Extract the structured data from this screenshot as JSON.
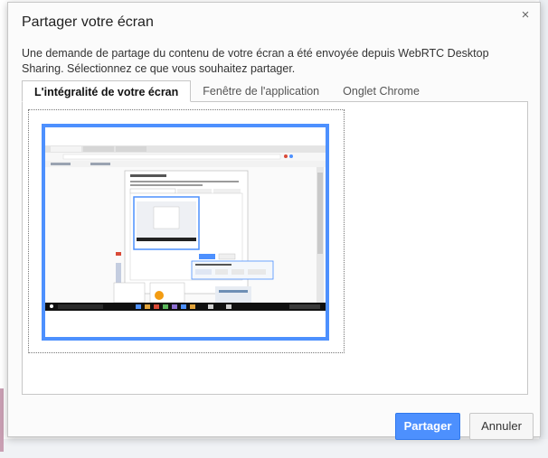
{
  "dialog": {
    "title": "Partager votre écran",
    "close_glyph": "×",
    "description": "Une demande de partage du contenu de votre écran a été envoyée depuis WebRTC Desktop Sharing. Sélectionnez ce que vous souhaitez partager."
  },
  "tabs": [
    {
      "label": "L'intégralité de votre écran",
      "selected": true
    },
    {
      "label": "Fenêtre de l'application",
      "selected": false
    },
    {
      "label": "Onglet Chrome",
      "selected": false
    }
  ],
  "buttons": {
    "share": "Partager",
    "cancel": "Annuler"
  },
  "colors": {
    "accent": "#4d90fe",
    "accent_border": "#3079ed"
  },
  "icons": {
    "close": "close-icon"
  }
}
